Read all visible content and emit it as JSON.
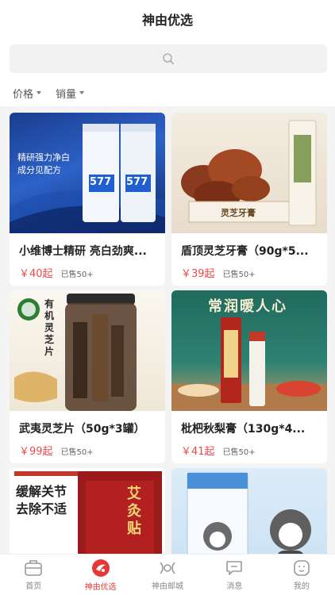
{
  "header": {
    "title": "神由优选"
  },
  "search": {
    "icon": "search-icon"
  },
  "filters": [
    {
      "label": "价格"
    },
    {
      "label": "销量"
    }
  ],
  "products": [
    {
      "name": "小维博士精研 亮白劲爽...",
      "price": "￥40起",
      "sold": "已售50+",
      "image": {
        "texts": [
          "精研强力净白",
          "成分见配方",
          "577",
          "577"
        ]
      }
    },
    {
      "name": "盾顶灵芝牙膏（90g*5...",
      "price": "￥39起",
      "sold": "已售50+",
      "image": {
        "texts": [
          "灵芝牙膏"
        ]
      }
    },
    {
      "name": "武夷灵芝片（50g*3罐）",
      "price": "￥99起",
      "sold": "已售50+",
      "image": {
        "texts": [
          "有机灵芝片"
        ]
      }
    },
    {
      "name": "枇杷秋梨膏（130g*4...",
      "price": "￥41起",
      "sold": "已售50+",
      "image": {
        "texts": [
          "常润暖人心"
        ]
      }
    },
    {
      "name": "",
      "price": "",
      "sold": "",
      "image": {
        "texts": [
          "缓解关节",
          "去除不适",
          "艾灸贴"
        ]
      }
    },
    {
      "name": "",
      "price": "",
      "sold": "",
      "image": {
        "texts": []
      }
    }
  ],
  "tabbar": [
    {
      "label": "首页",
      "icon": "home-icon",
      "active": false
    },
    {
      "label": "神由优选",
      "icon": "shenyou-logo-icon",
      "active": true
    },
    {
      "label": "神由邮城",
      "icon": "mall-icon",
      "active": false
    },
    {
      "label": "消息",
      "icon": "message-icon",
      "active": false
    },
    {
      "label": "我的",
      "icon": "profile-icon",
      "active": false
    }
  ],
  "colors": {
    "accent": "#e53935",
    "price": "#e84b4b",
    "background": "#f4f4f4"
  }
}
